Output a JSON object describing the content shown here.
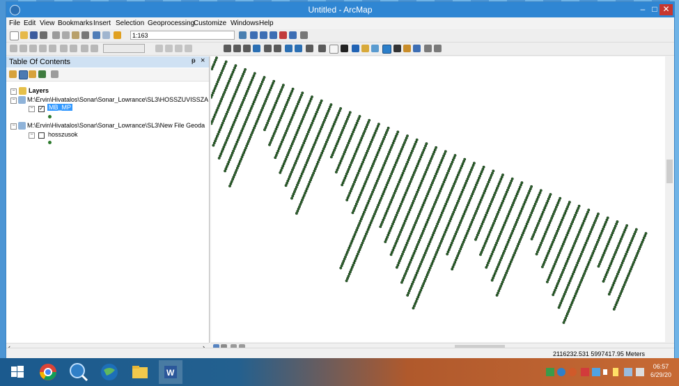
{
  "window": {
    "title": "Untitled - ArcMap",
    "min_glyph": "–",
    "max_glyph": "□",
    "close_glyph": "✕"
  },
  "menu": [
    "File",
    "Edit",
    "View",
    "Bookmarks",
    "Insert",
    "Selection",
    "Geoprocessing",
    "Customize",
    "Windows",
    "Help"
  ],
  "toolbar": {
    "scale": "1:163"
  },
  "toc": {
    "title": "Table Of Contents",
    "pin_glyph": "ᵽ",
    "close_glyph": "×",
    "root": "Layers",
    "path1": "M:\\Ervin\\Hivatalos\\Sonar\\Sonar_Lowrance\\SL3\\HOSSZUVISSZA",
    "layer1": "MB_MP",
    "path2": "M:\\Ervin\\Hivatalos\\Sonar\\Sonar_Lowrance\\SL3\\New File Geoda",
    "layer2": "hosszusok"
  },
  "status": {
    "coords": "2116232.531  5997417.95 Meters"
  },
  "clock": {
    "time": "06:57",
    "date": "6/29/20"
  },
  "colors": {
    "titlebar": "#2f86d3",
    "point": "#2f6b2f",
    "point_outline": "#0d2a0d"
  }
}
